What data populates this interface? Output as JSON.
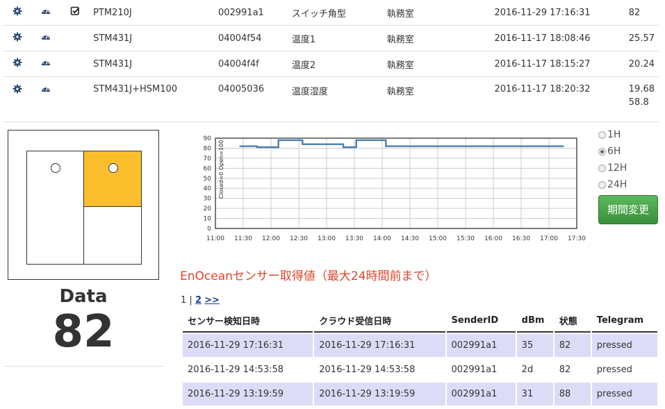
{
  "sensors": [
    {
      "model": "PTM210J",
      "id": "002991a1",
      "name": "スイッチ角型",
      "location": "執務室",
      "timestamp": "2016-11-29 17:16:31",
      "value": "82",
      "checked": true
    },
    {
      "model": "STM431J",
      "id": "04004f54",
      "name": "温度1",
      "location": "執務室",
      "timestamp": "2016-11-17 18:08:46",
      "value": "25.57",
      "checked": false
    },
    {
      "model": "STM431J",
      "id": "04004f4f",
      "name": "温度2",
      "location": "執務室",
      "timestamp": "2016-11-17 18:15:27",
      "value": "20.24",
      "checked": false
    },
    {
      "model": "STM431J+HSM100",
      "id": "04005036",
      "name": "温度湿度",
      "location": "執務室",
      "timestamp": "2016-11-17 18:20:32",
      "value": "19.68",
      "value2": "58.8",
      "checked": false
    }
  ],
  "icons": {
    "settings": "gear-icon",
    "dashboard": "speedometer-icon",
    "checkbox": "checked-square-icon"
  },
  "panel": {
    "label": "Data",
    "value": "82"
  },
  "colors": {
    "active_room": "#fbbf2e",
    "line": "#4a7fb0",
    "button": "#4cae4c",
    "title": "#e0452b",
    "row_highlight": "#dcdcf8"
  },
  "chart_data": {
    "type": "line",
    "ylabel": "Closed=0 Open=100",
    "ylim": [
      0,
      90
    ],
    "yticks": [
      0,
      10,
      20,
      30,
      40,
      50,
      60,
      70,
      80,
      90
    ],
    "xticks": [
      "11:00",
      "11:30",
      "12:00",
      "12:30",
      "13:00",
      "13:30",
      "14:00",
      "14:30",
      "15:00",
      "15:30",
      "16:00",
      "16:30",
      "17:00",
      "17:30"
    ],
    "grid": true,
    "step": true,
    "series": [
      {
        "x": [
          "11:26",
          "11:45",
          "12:08",
          "12:08",
          "12:34",
          "13:18",
          "13:32",
          "14:04",
          "17:16"
        ],
        "y": [
          82,
          81,
          82,
          88,
          84,
          81,
          88,
          82,
          82
        ]
      }
    ]
  },
  "periods": {
    "options": [
      "1H",
      "6H",
      "12H",
      "24H"
    ],
    "selected": "6H"
  },
  "change_button": "期間変更",
  "section_title": "EnOceanセンサー取得値（最大24時間前まで）",
  "pager": {
    "current": "1",
    "separator": "|",
    "next": "2",
    "more": ">>"
  },
  "log": {
    "headers": [
      "センサー検知日時",
      "クラウド受信日時",
      "SenderID",
      "dBm",
      "状態",
      "Telegram"
    ],
    "rows": [
      [
        "2016-11-29 17:16:31",
        "2016-11-29 17:16:31",
        "002991a1",
        "35",
        "82",
        "pressed"
      ],
      [
        "2016-11-29 14:53:58",
        "2016-11-29 14:53:58",
        "002991a1",
        "2d",
        "82",
        "pressed"
      ],
      [
        "2016-11-29 13:19:59",
        "2016-11-29 13:19:59",
        "002991a1",
        "31",
        "88",
        "pressed"
      ]
    ]
  }
}
